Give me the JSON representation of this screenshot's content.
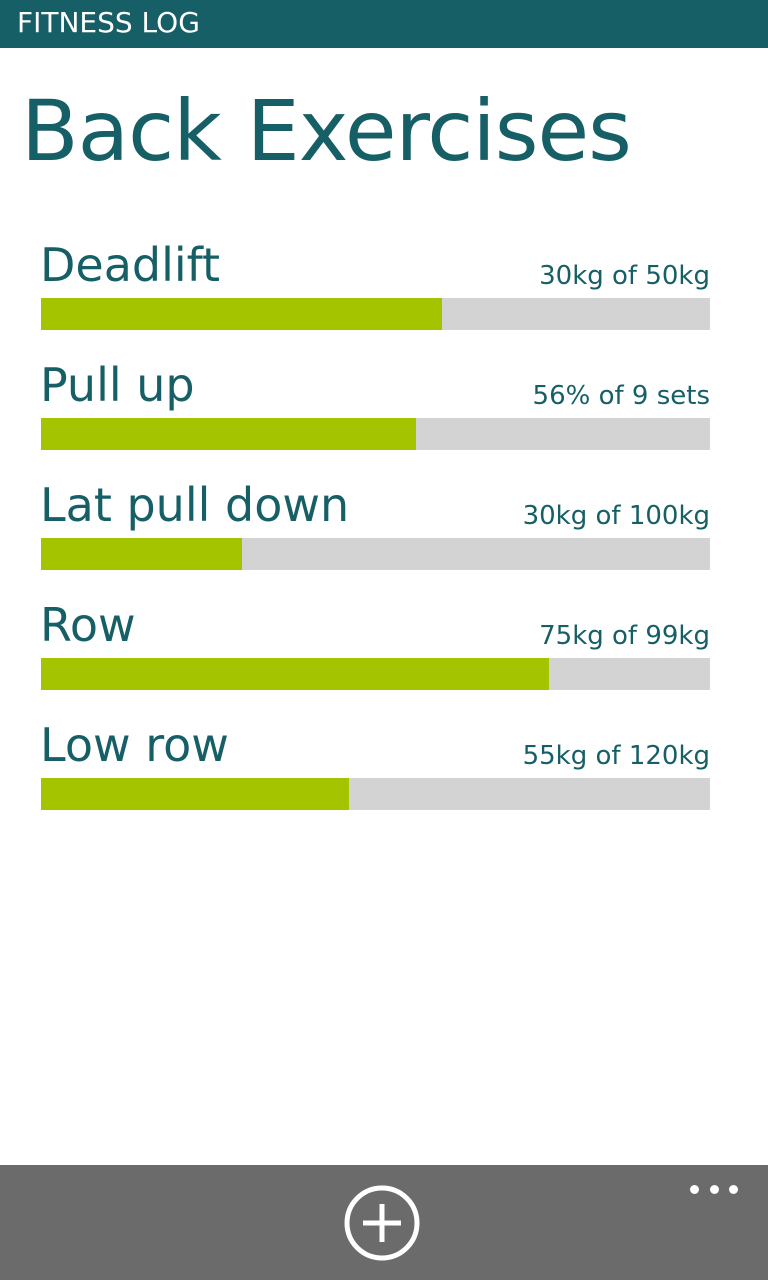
{
  "app": {
    "name": "FITNESS LOG"
  },
  "page": {
    "title": "Back Exercises"
  },
  "colors": {
    "header": "#175f66",
    "text": "#175f66",
    "progress_fill": "#a5c400",
    "progress_track": "#d3d3d3",
    "app_bar": "#6b6b6b"
  },
  "exercises": [
    {
      "name": "Deadlift",
      "progress_text": "30kg of 50kg",
      "progress": 0.6
    },
    {
      "name": "Pull up",
      "progress_text": "56% of 9 sets",
      "progress": 0.56
    },
    {
      "name": "Lat pull down",
      "progress_text": "30kg of 100kg",
      "progress": 0.3
    },
    {
      "name": "Row",
      "progress_text": "75kg of 99kg",
      "progress": 0.76
    },
    {
      "name": "Low row",
      "progress_text": "55kg of 120kg",
      "progress": 0.46
    }
  ],
  "app_bar": {
    "add_icon": "add-circle-icon",
    "more_icon": "more-dots-icon"
  }
}
